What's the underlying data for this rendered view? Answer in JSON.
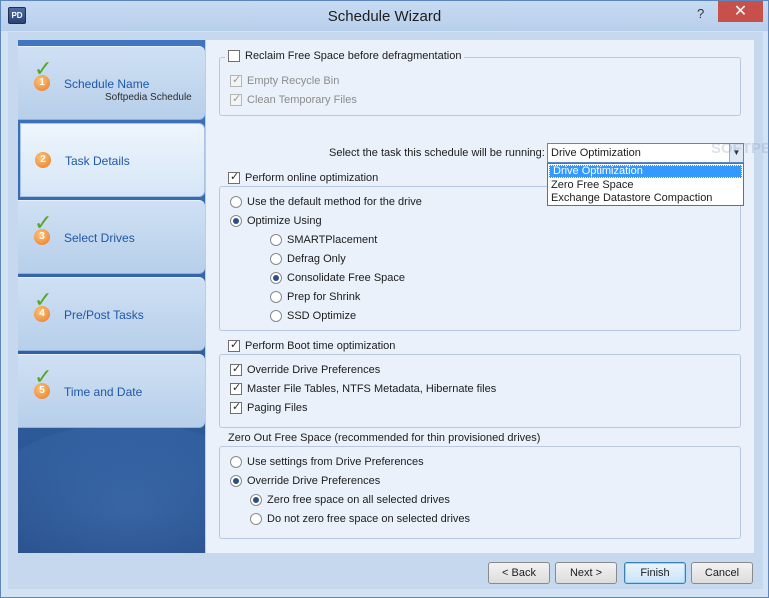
{
  "window": {
    "title": "Schedule Wizard",
    "app_icon_text": "PD",
    "help": "?",
    "close": "✕"
  },
  "sidebar": {
    "steps": [
      {
        "number": "1",
        "label": "Schedule Name",
        "sub": "Softpedia Schedule",
        "completed": true,
        "active": false
      },
      {
        "number": "2",
        "label": "Task Details",
        "sub": "",
        "completed": false,
        "active": true
      },
      {
        "number": "3",
        "label": "Select Drives",
        "sub": "",
        "completed": true,
        "active": false
      },
      {
        "number": "4",
        "label": "Pre/Post Tasks",
        "sub": "",
        "completed": true,
        "active": false
      },
      {
        "number": "5",
        "label": "Time and Date",
        "sub": "",
        "completed": true,
        "active": false
      }
    ]
  },
  "reclaim": {
    "label": "Reclaim Free Space before defragmentation",
    "checked": false,
    "empty_recycle": "Empty Recycle Bin",
    "clean_temp": "Clean Temporary Files"
  },
  "task": {
    "prompt": "Select the task this schedule will be running:",
    "selected": "Drive Optimization",
    "options": [
      "Drive Optimization",
      "Zero Free Space",
      "Exchange Datastore Compaction"
    ]
  },
  "online": {
    "label": "Perform online optimization",
    "default_method": "Use the default method for the drive",
    "optimize_using": "Optimize Using",
    "methods": [
      "SMARTPlacement",
      "Defrag Only",
      "Consolidate Free Space",
      "Prep for Shrink",
      "SSD Optimize"
    ],
    "selected_method": "Consolidate Free Space"
  },
  "boot": {
    "label": "Perform Boot time optimization",
    "override": "Override Drive Preferences",
    "mft": "Master File Tables, NTFS Metadata, Hibernate files",
    "paging": "Paging Files"
  },
  "zero": {
    "label": "Zero Out Free Space (recommended for thin provisioned drives)",
    "use_settings": "Use settings from Drive Preferences",
    "override": "Override Drive Preferences",
    "zero_all": "Zero free space on all selected drives",
    "do_not_zero": "Do not zero free space on selected drives"
  },
  "buttons": {
    "back": "< Back",
    "next": "Next >",
    "finish": "Finish",
    "cancel": "Cancel"
  }
}
